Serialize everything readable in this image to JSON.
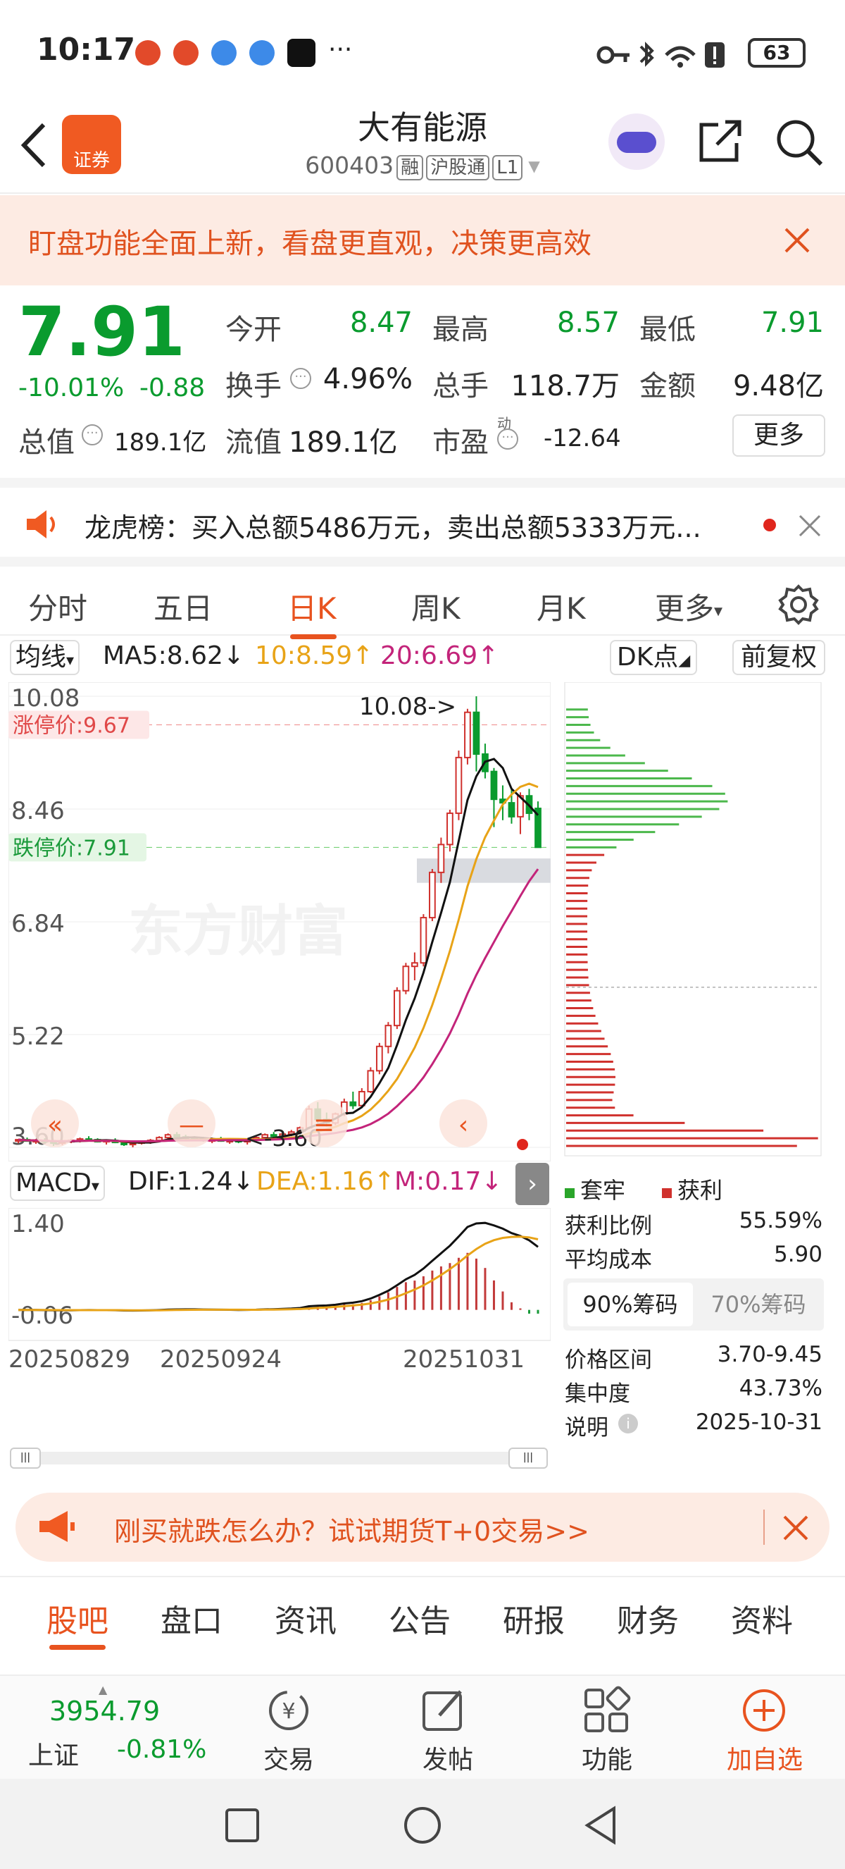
{
  "status": {
    "time": "10:17",
    "battery": "63"
  },
  "header": {
    "title": "大有能源",
    "code": "600403",
    "tags": [
      "融",
      "沪股通",
      "L1"
    ],
    "logo_text": "证券"
  },
  "banner": {
    "text": "盯盘功能全面上新，看盘更直观，决策更高效"
  },
  "quote": {
    "price": "7.91",
    "change_pct": "-10.01%",
    "change": "-0.88",
    "open_label": "今开",
    "open": "8.47",
    "high_label": "最高",
    "high": "8.57",
    "low_label": "最低",
    "low": "7.91",
    "turnover_label": "换手",
    "turnover": "4.96%",
    "volume_label": "总手",
    "volume": "118.7万",
    "amount_label": "金额",
    "amount": "9.48亿",
    "mktcap_label": "总值",
    "mktcap": "189.1亿",
    "float_label": "流值",
    "float_cap": "189.1亿",
    "pe_label": "市盈",
    "pe_sup": "动",
    "pe": "-12.64",
    "more": "更多"
  },
  "notice": {
    "text": "龙虎榜：买入总额5486万元，卖出总额5333万元..."
  },
  "tabs": [
    "分时",
    "五日",
    "日K",
    "周K",
    "月K",
    "更多"
  ],
  "active_tab": "日K",
  "indicator": {
    "ma_label": "均线",
    "ma5": "MA5:8.62↓",
    "ma10": "10:8.59↑",
    "ma20": "20:6.69↑",
    "dk": "DK点",
    "adjust": "前复权",
    "limit_up": "涨停价:9.67",
    "limit_down": "跌停价:7.91",
    "high_mark": "10.08->",
    "low_mark": "<-3.60",
    "watermark": "东方财富",
    "macd_label": "MACD",
    "dif": "DIF:1.24↓",
    "dea": "DEA:1.16↑",
    "m": "M:0.17↓"
  },
  "chip": {
    "legend_trapped": "套牢",
    "legend_profit": "获利",
    "profit_ratio_label": "获利比例",
    "profit_ratio": "55.59%",
    "avg_cost_label": "平均成本",
    "avg_cost": "5.90",
    "tab90": "90%筹码",
    "tab70": "70%筹码",
    "range_label": "价格区间",
    "range": "3.70-9.45",
    "conc_label": "集中度",
    "conc": "43.73%",
    "note_label": "说明",
    "note": "2025-10-31"
  },
  "ad": {
    "text": "刚买就跌怎么办？试试期货T+0交易>>"
  },
  "bottom_tabs": [
    "股吧",
    "盘口",
    "资讯",
    "公告",
    "研报",
    "财务",
    "资料"
  ],
  "index": {
    "value": "3954.79",
    "name": "上证",
    "change": "-0.81%"
  },
  "bottom_bar": [
    "交易",
    "发帖",
    "功能",
    "加自选"
  ],
  "colors": {
    "accent": "#e8531f",
    "down": "#0a9b2e",
    "up": "#d0312d"
  },
  "chart_data": {
    "type": "candlestick",
    "y_ticks": [
      "10.08",
      "8.46",
      "6.84",
      "5.22",
      "3.60"
    ],
    "macd_y_ticks": [
      "1.40",
      "-0.06"
    ],
    "x_ticks": [
      "20250829",
      "20250924",
      "20251031"
    ],
    "ylim": [
      3.6,
      10.08
    ],
    "candles": [
      [
        3.7,
        3.72,
        3.66,
        3.71
      ],
      [
        3.71,
        3.74,
        3.68,
        3.69
      ],
      [
        3.69,
        3.72,
        3.65,
        3.7
      ],
      [
        3.7,
        3.73,
        3.66,
        3.68
      ],
      [
        3.68,
        3.7,
        3.62,
        3.66
      ],
      [
        3.66,
        3.7,
        3.63,
        3.69
      ],
      [
        3.69,
        3.72,
        3.66,
        3.7
      ],
      [
        3.7,
        3.74,
        3.67,
        3.72
      ],
      [
        3.72,
        3.76,
        3.7,
        3.71
      ],
      [
        3.71,
        3.73,
        3.67,
        3.68
      ],
      [
        3.68,
        3.71,
        3.64,
        3.7
      ],
      [
        3.7,
        3.73,
        3.66,
        3.67
      ],
      [
        3.67,
        3.7,
        3.62,
        3.64
      ],
      [
        3.64,
        3.68,
        3.6,
        3.66
      ],
      [
        3.66,
        3.7,
        3.64,
        3.68
      ],
      [
        3.68,
        3.72,
        3.65,
        3.7
      ],
      [
        3.7,
        3.76,
        3.68,
        3.74
      ],
      [
        3.74,
        3.8,
        3.7,
        3.78
      ],
      [
        3.78,
        3.82,
        3.72,
        3.75
      ],
      [
        3.75,
        3.78,
        3.7,
        3.73
      ],
      [
        3.73,
        3.76,
        3.69,
        3.72
      ],
      [
        3.72,
        3.75,
        3.68,
        3.7
      ],
      [
        3.7,
        3.74,
        3.66,
        3.71
      ],
      [
        3.71,
        3.75,
        3.68,
        3.69
      ],
      [
        3.69,
        3.72,
        3.65,
        3.7
      ],
      [
        3.7,
        3.73,
        3.66,
        3.68
      ],
      [
        3.68,
        3.72,
        3.64,
        3.71
      ],
      [
        3.71,
        3.76,
        3.69,
        3.74
      ],
      [
        3.74,
        3.8,
        3.72,
        3.78
      ],
      [
        3.78,
        3.82,
        3.74,
        3.76
      ],
      [
        3.76,
        3.8,
        3.72,
        3.79
      ],
      [
        3.79,
        3.85,
        3.76,
        3.82
      ],
      [
        3.82,
        3.9,
        3.8,
        3.88
      ],
      [
        3.88,
        4.2,
        3.86,
        4.15
      ],
      [
        4.15,
        4.25,
        3.95,
        4.0
      ],
      [
        4.0,
        4.1,
        3.9,
        3.95
      ],
      [
        3.95,
        4.1,
        3.92,
        4.08
      ],
      [
        4.08,
        4.3,
        4.05,
        4.25
      ],
      [
        4.25,
        4.4,
        4.15,
        4.2
      ],
      [
        4.2,
        4.45,
        4.18,
        4.4
      ],
      [
        4.4,
        4.75,
        4.38,
        4.7
      ],
      [
        4.7,
        5.1,
        4.65,
        5.05
      ],
      [
        5.05,
        5.4,
        4.95,
        5.35
      ],
      [
        5.35,
        5.9,
        5.3,
        5.85
      ],
      [
        5.85,
        6.25,
        5.8,
        6.2
      ],
      [
        6.2,
        6.4,
        6.0,
        6.25
      ],
      [
        6.25,
        6.95,
        6.2,
        6.9
      ],
      [
        6.9,
        7.6,
        6.85,
        7.55
      ],
      [
        7.55,
        8.05,
        7.4,
        7.95
      ],
      [
        7.95,
        8.45,
        7.85,
        8.4
      ],
      [
        8.4,
        9.3,
        8.3,
        9.2
      ],
      [
        9.2,
        9.9,
        9.1,
        9.85
      ],
      [
        9.85,
        10.08,
        9.0,
        9.25
      ],
      [
        9.25,
        9.4,
        8.9,
        9.0
      ],
      [
        9.0,
        9.05,
        8.2,
        8.6
      ],
      [
        8.6,
        8.8,
        8.3,
        8.55
      ],
      [
        8.55,
        8.75,
        8.25,
        8.35
      ],
      [
        8.35,
        8.7,
        8.1,
        8.65
      ],
      [
        8.65,
        8.75,
        8.3,
        8.4
      ],
      [
        8.47,
        8.57,
        7.91,
        7.91
      ]
    ]
  }
}
